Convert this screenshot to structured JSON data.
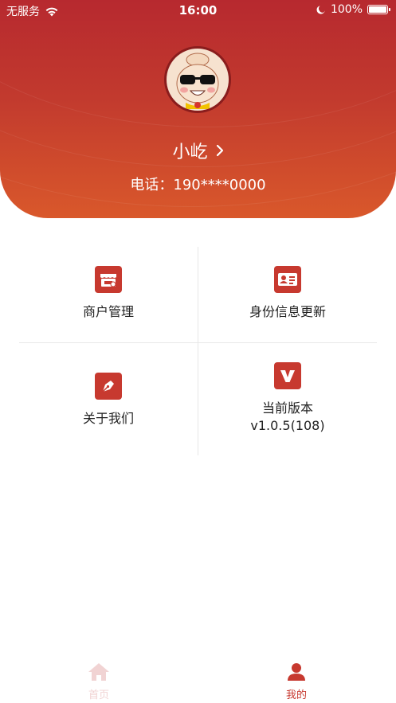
{
  "status_bar": {
    "carrier": "无服务",
    "time": "16:00",
    "battery": "100%"
  },
  "profile": {
    "name": "小屹",
    "phone": "电话：190****0000"
  },
  "menu": {
    "items": [
      {
        "label": "商户管理",
        "icon": "store-icon"
      },
      {
        "label": "身份信息更新",
        "icon": "id-card-icon"
      },
      {
        "label": "关于我们",
        "icon": "pen-icon"
      },
      {
        "label": "当前版本",
        "sublabel": "v1.0.5(108)",
        "icon": "version-icon"
      }
    ]
  },
  "tabbar": {
    "home_label": "首页",
    "mine_label": "我的",
    "active_color": "#c7392f",
    "inactive_color": "#f1d3d3"
  },
  "colors": {
    "accent": "#c7392f",
    "header_top": "#b7292f",
    "header_bottom": "#d9582b"
  }
}
